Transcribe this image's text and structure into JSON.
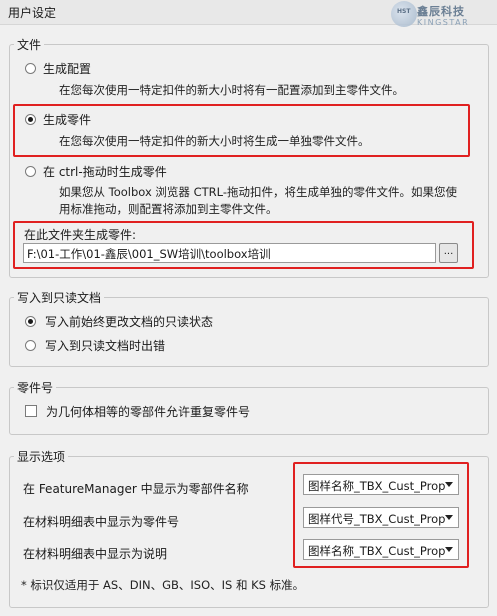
{
  "window": {
    "title": "用户设定"
  },
  "logo": {
    "badge": "HST",
    "cn": "鑫辰科技",
    "en": "KINGSTAR"
  },
  "file_group": {
    "legend": "文件",
    "options": [
      {
        "label": "生成配置",
        "desc": "在您每次使用一特定扣件的新大小时将有一配置添加到主零件文件。",
        "selected": false
      },
      {
        "label": "生成零件",
        "desc": "在您每次使用一特定扣件的新大小时将生成一单独零件文件。",
        "selected": true
      },
      {
        "label": "在 ctrl-拖动时生成零件",
        "desc": "如果您从 Toolbox 浏览器 CTRL-拖动扣件，将生成单独的零件文件。如果您使",
        "desc2": "用标准拖动，则配置将添加到主零件文件。",
        "selected": false
      }
    ],
    "folder_label": "在此文件夹生成零件:",
    "folder_path": "F:\\01-工作\\01-鑫辰\\001_SW培训\\toolbox培训",
    "browse_label": "..."
  },
  "readonly_group": {
    "legend": "写入到只读文档",
    "options": [
      {
        "label": "写入前始终更改文档的只读状态",
        "selected": true
      },
      {
        "label": "写入到只读文档时出错",
        "selected": false
      }
    ]
  },
  "partnum_group": {
    "legend": "零件号",
    "checkbox_label": "为几何体相等的零部件允许重复零件号",
    "checked": false
  },
  "display_group": {
    "legend": "显示选项",
    "rows": [
      {
        "label": "在 FeatureManager 中显示为零部件名称",
        "value": "图样名称_TBX_Cust_Prop"
      },
      {
        "label": "在材料明细表中显示为零件号",
        "value": "图样代号_TBX_Cust_Prop"
      },
      {
        "label": "在材料明细表中显示为说明",
        "value": "图样名称_TBX_Cust_Prop"
      }
    ],
    "footnote": "* 标识仅适用于 AS、DIN、GB、ISO、IS 和 KS 标准。"
  },
  "colors": {
    "highlight": "#e02020",
    "background": "#f0f0f0"
  }
}
